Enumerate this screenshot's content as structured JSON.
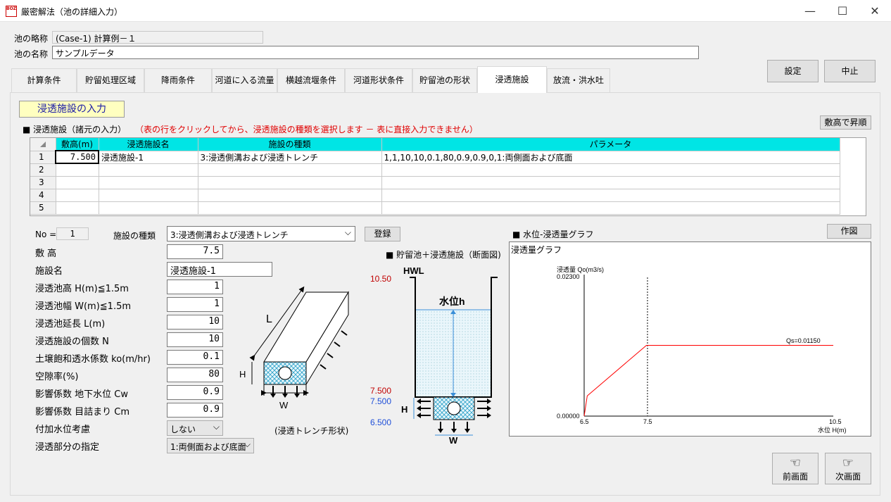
{
  "window": {
    "icon_text": "BOZ",
    "title": "厳密解法（池の詳細入力）",
    "minimize": "—",
    "maximize": "☐",
    "close": "✕"
  },
  "header": {
    "short_name_label": "池の略称",
    "short_name_value": "(Case-1) 計算例－１",
    "name_label": "池の名称",
    "name_value": "サンプルデータ",
    "settings_button": "設定",
    "cancel_button": "中止"
  },
  "tabs": [
    {
      "label": "計算条件"
    },
    {
      "label": "貯留処理区域"
    },
    {
      "label": "降雨条件"
    },
    {
      "label": "河道に入る流量"
    },
    {
      "label": "横越流堰条件"
    },
    {
      "label": "河道形状条件"
    },
    {
      "label": "貯留池の形状"
    },
    {
      "label": "浸透施設"
    },
    {
      "label": "放流・洪水吐"
    }
  ],
  "section": {
    "title": "浸透施設の入力",
    "table_heading": "■ 浸透施設（諸元の入力）",
    "table_note": "（表の行をクリックしてから、浸透施設の種類を選択します － 表に直接入力できません）",
    "sort_button": "敷高で昇順"
  },
  "table": {
    "columns": [
      "敷高(m)",
      "浸透施設名",
      "施設の種類",
      "パラメータ"
    ],
    "rows": [
      {
        "no": "1",
        "cells": [
          "7.500",
          "浸透施設-1",
          "3:浸透側溝および浸透トレンチ",
          "1,1,10,10,0.1,80,0.9,0.9,0,1:両側面および底面"
        ]
      },
      {
        "no": "2",
        "cells": [
          "",
          "",
          "",
          ""
        ]
      },
      {
        "no": "3",
        "cells": [
          "",
          "",
          "",
          ""
        ]
      },
      {
        "no": "4",
        "cells": [
          "",
          "",
          "",
          ""
        ]
      },
      {
        "no": "5",
        "cells": [
          "",
          "",
          "",
          ""
        ]
      }
    ]
  },
  "form": {
    "no_label": "No =",
    "no_value": "1",
    "type_label": "施設の種類",
    "type_value": "3:浸透側溝および浸透トレンチ",
    "register_button": "登録",
    "fields": [
      {
        "label": "敷 高",
        "value": "7.5"
      },
      {
        "label": "施設名",
        "value": "浸透施設-1"
      },
      {
        "label": "浸透池高 H(m)≦1.5m",
        "value": "1"
      },
      {
        "label": "浸透池幅 W(m)≦1.5m",
        "value": "1"
      },
      {
        "label": "浸透池延長 L(m)",
        "value": "10"
      },
      {
        "label": "浸透施設の個数 N",
        "value": "10"
      },
      {
        "label": "土壌飽和透水係数 ko(m/hr)",
        "value": "0.1"
      },
      {
        "label": "空隙率(%)",
        "value": "80"
      },
      {
        "label": "影響係数 地下水位 Cw",
        "value": "0.9"
      },
      {
        "label": "影響係数 目詰まり Cm",
        "value": "0.9"
      }
    ],
    "extra_label": "付加水位考慮",
    "extra_value": "しない",
    "part_label": "浸透部分の指定",
    "part_value": "1:両側面および底面"
  },
  "trench_figure": {
    "label_L": "L",
    "label_H": "H",
    "label_W": "W",
    "caption": "(浸透トレンチ形状)"
  },
  "section_figure": {
    "title": "■ 貯留池＋浸透施設（断面図)",
    "hwl": "HWL",
    "water_level": "水位h",
    "elev_top": "10.50",
    "elev_mid_red": "7.500",
    "elev_mid_blue": "7.500",
    "elev_bottom": "6.500",
    "label_H": "H",
    "label_W": "W"
  },
  "graph": {
    "heading": "■ 水位-浸透量グラフ",
    "draw_button": "作図",
    "inner_title": "浸透量グラフ",
    "y_axis_label": "浸透量 Qo(m3/s)",
    "y_max_label": "0.02300",
    "y_min_label": "0.00000",
    "x_axis_label": "水位 H(m)",
    "x_ticks": [
      "6.5",
      "7.5",
      "10.5"
    ],
    "qs_label": "Qs=0.01150"
  },
  "chart_data": {
    "type": "line",
    "title": "浸透量グラフ",
    "xlabel": "水位 H(m)",
    "ylabel": "浸透量 Qo(m3/s)",
    "xlim": [
      6.5,
      10.5
    ],
    "ylim": [
      0,
      0.023
    ],
    "series": [
      {
        "values": [
          [
            6.5,
            0.0
          ],
          [
            6.55,
            0.0033
          ],
          [
            7.5,
            0.0115
          ],
          [
            10.5,
            0.0115
          ]
        ]
      }
    ],
    "reference_line_x": 7.5,
    "line_color": "#ff0000"
  },
  "nav": {
    "prev_label": "前画面",
    "next_label": "次画面"
  }
}
